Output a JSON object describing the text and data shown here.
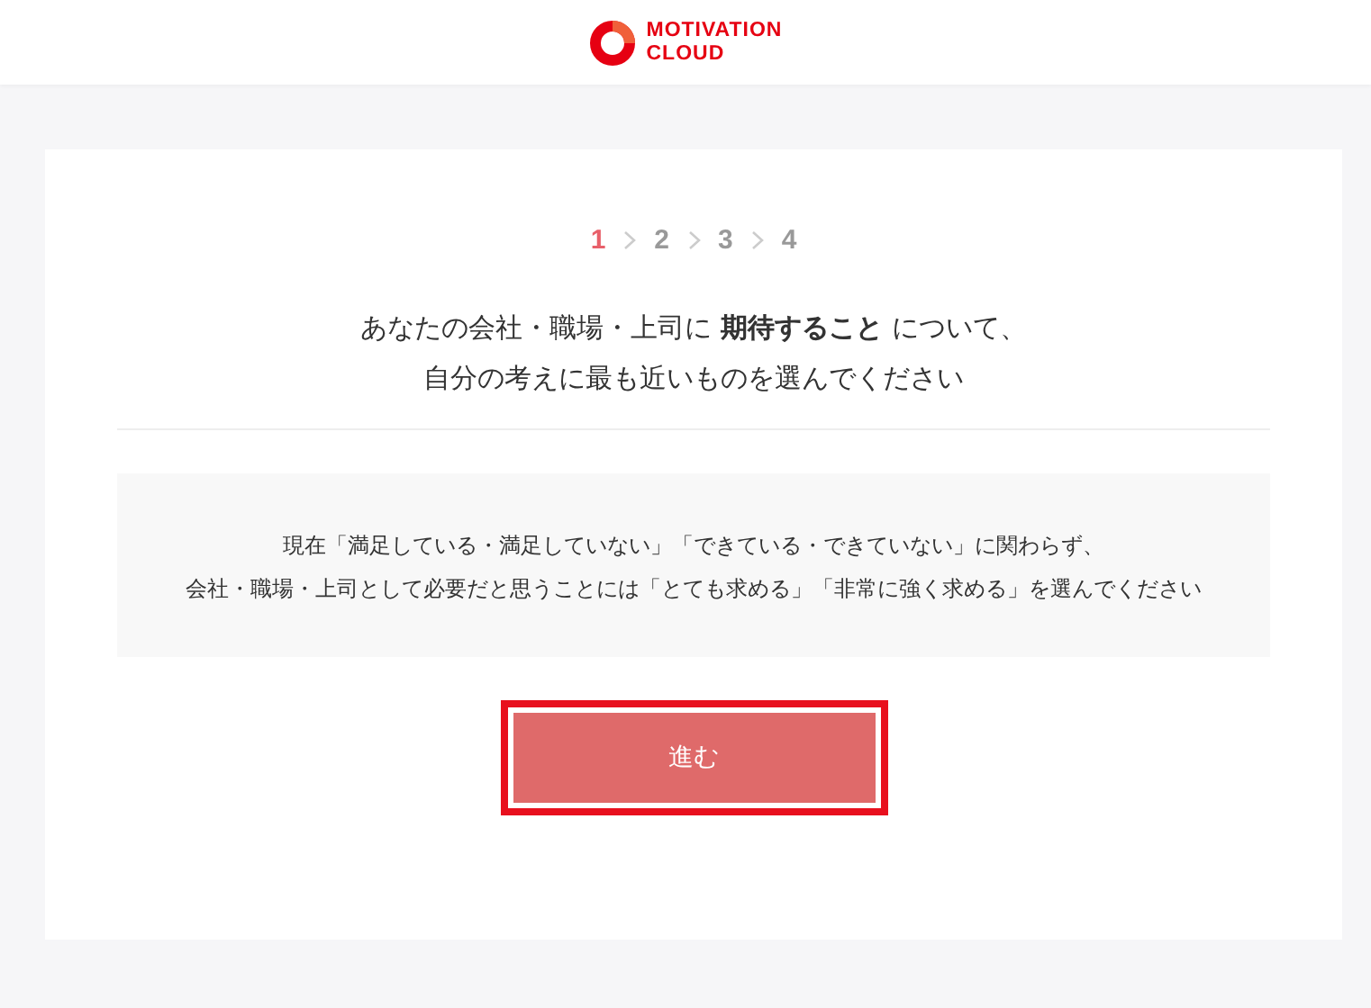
{
  "header": {
    "logo_text": [
      "MOTIVATION",
      "CLOUD"
    ]
  },
  "steps": [
    {
      "label": "1",
      "selected": true
    },
    {
      "label": "2",
      "selected": false
    },
    {
      "label": "3",
      "selected": false
    },
    {
      "label": "4",
      "selected": false
    }
  ],
  "heading": [
    "あなたの会社・職場・上司に **期待すること** について、",
    "自分の考えに最も近いものを選んでください"
  ],
  "note": [
    "現在「満足している・満足していない」「できている・できていない」に関わらず、",
    "会社・職場・上司として必要だと思うことには「とても求める」「非常に強く求める」を選んでください"
  ],
  "button": {
    "label": "進む",
    "highlighted": true
  }
}
